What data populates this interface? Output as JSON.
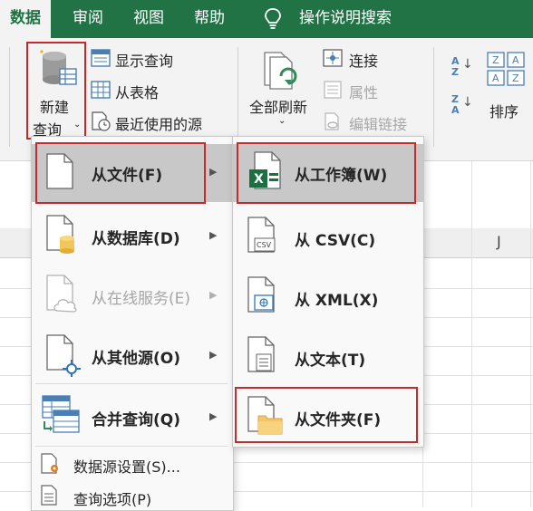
{
  "ribbon_tabs": {
    "data": "数据",
    "review": "审阅",
    "view": "视图",
    "help": "帮助",
    "search": "操作说明搜索"
  },
  "ribbon": {
    "new_query_line1": "新建",
    "new_query_line2": "查询",
    "show_queries": "显示查询",
    "from_table": "从表格",
    "recent_sources": "最近使用的源",
    "refresh_all": "全部刷新",
    "connections": "连接",
    "properties": "属性",
    "edit_links": "编辑链接",
    "sort": "排序"
  },
  "sheet": {
    "column_j": "J"
  },
  "menu_main": {
    "items": [
      {
        "label": "从文件(F)",
        "selected": true
      },
      {
        "label": "从数据库(D)"
      },
      {
        "label": "从在线服务(E)",
        "disabled": true
      },
      {
        "label": "从其他源(O)"
      },
      {
        "label": "合并查询(Q)"
      },
      {
        "label": "数据源设置(S)..."
      },
      {
        "label": "查询选项(P)"
      }
    ]
  },
  "menu_sub": {
    "items": [
      {
        "label": "从工作簿(W)",
        "selected": true,
        "icon": "excel-workbook-icon"
      },
      {
        "label": "从 CSV(C)",
        "icon": "csv-file-icon"
      },
      {
        "label": "从 XML(X)",
        "icon": "xml-file-icon"
      },
      {
        "label": "从文本(T)",
        "icon": "text-file-icon"
      },
      {
        "label": "从文件夹(F)",
        "icon": "folder-icon"
      }
    ]
  },
  "colors": {
    "excel_green": "#217346",
    "highlight_red": "#c42b2b",
    "selected_item": "#c8c8c8"
  }
}
